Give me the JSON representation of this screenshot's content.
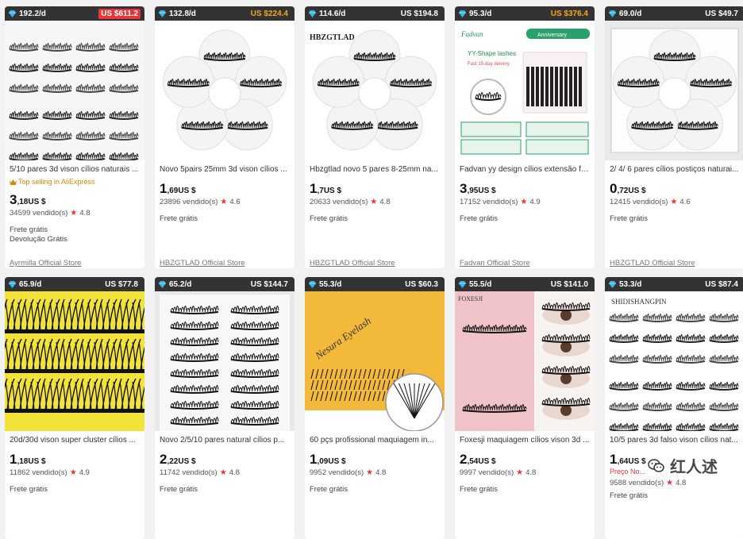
{
  "products": [
    {
      "sales_per_day": "192.2/d",
      "revenue": "US $611.2",
      "revenue_style": "hot",
      "title": "5/10 pares 3d vison cílios naturais ...",
      "badge": "Top selling in AliExpress",
      "price_int": "3",
      "price_dec": ",18",
      "currency": "US $",
      "sold": "34599 vendido(s)",
      "rating": "4.8",
      "shipping": "Frete grátis",
      "returns": "Devolução Grátis",
      "store": "Ayrmilla Official Store",
      "image": "lash-grid-dark"
    },
    {
      "sales_per_day": "132.8/d",
      "revenue": "US $224.4",
      "revenue_style": "gold",
      "title": "Novo 5pairs 25mm 3d vison cílios ...",
      "price_int": "1",
      "price_dec": ",69",
      "currency": "US $",
      "sold": "23896 vendido(s)",
      "rating": "4.6",
      "shipping": "Frete grátis",
      "store": "HBZGTLAD Official Store",
      "image": "lash-flower"
    },
    {
      "sales_per_day": "114.6/d",
      "revenue": "US $194.8",
      "revenue_style": "plain",
      "title": "Hbzgtlad novo 5 pares 8-25mm na...",
      "price_int": "1",
      "price_dec": ",7",
      "currency": "US $",
      "sold": "20633 vendido(s)",
      "rating": "4.8",
      "shipping": "Frete grátis",
      "store": "HBZGTLAD Official Store",
      "image": "lash-flower-branded",
      "brand_text": "HBZGTLAD"
    },
    {
      "sales_per_day": "95.3/d",
      "revenue": "US $376.4",
      "revenue_style": "gold",
      "title": "Fadvan yy design cílios extensão fa...",
      "price_int": "3",
      "price_dec": ",95",
      "currency": "US $",
      "sold": "17152 vendido(s)",
      "rating": "4.9",
      "shipping": "Frete grátis",
      "store": "Fadvan Official Store",
      "image": "lash-extension-box",
      "brand_text": "Fadvan",
      "anniv_text": "Anniversary",
      "promo_line1": "YY-Shape lashes",
      "promo_line2": "Fast 15-day deivery"
    },
    {
      "sales_per_day": "69.0/d",
      "revenue": "US $49.7",
      "revenue_style": "plain",
      "title": "2/ 4/ 6 pares cílios postiços naturai...",
      "price_int": "0",
      "price_dec": ",72",
      "currency": "US $",
      "sold": "12415 vendido(s)",
      "rating": "4.6",
      "shipping": "Frete grátis",
      "store": "HBZGTLAD Official Store",
      "image": "lash-flower-box"
    },
    {
      "sales_per_day": "65.9/d",
      "revenue": "US $77.8",
      "revenue_style": "plain",
      "title": "20d/30d vison super cluster cílios ...",
      "price_int": "1",
      "price_dec": ",18",
      "currency": "US $",
      "sold": "11862 vendido(s)",
      "rating": "4.9",
      "shipping": "Frete grátis",
      "image": "lash-cluster-yellow"
    },
    {
      "sales_per_day": "65.2/d",
      "revenue": "US $144.7",
      "revenue_style": "plain",
      "title": "Novo 2/5/10 pares natural cílios p...",
      "price_int": "2",
      "price_dec": ",22",
      "currency": "US $",
      "sold": "11742 vendido(s)",
      "rating": "4.8",
      "shipping": "Frete grátis",
      "image": "lash-strip-tray"
    },
    {
      "sales_per_day": "55.3/d",
      "revenue": "US $60.3",
      "revenue_style": "plain",
      "title": "60 pçs profissional maquiagem in...",
      "price_int": "1",
      "price_dec": ",09",
      "currency": "US $",
      "sold": "9952 vendido(s)",
      "rating": "4.8",
      "shipping": "Frete grátis",
      "image": "lash-individual-yellow",
      "brand_text": "Nesura Eyelash"
    },
    {
      "sales_per_day": "55.5/d",
      "revenue": "US $141.0",
      "revenue_style": "plain",
      "title": "Foxesji maquiagem cílios vison 3d ...",
      "price_int": "2",
      "price_dec": ",54",
      "currency": "US $",
      "sold": "9997 vendido(s)",
      "rating": "4.8",
      "shipping": "Frete grátis",
      "image": "lash-pink-eyes",
      "brand_text": "FOXESJI"
    },
    {
      "sales_per_day": "53.3/d",
      "revenue": "US $87.4",
      "revenue_style": "plain",
      "title": "10/5 pares 3d falso vison cílios nat...",
      "price_int": "1",
      "price_dec": ",64",
      "currency": "US $",
      "sold": "9588 vendido(s)",
      "rating": "4.8",
      "shipping": "Frete grátis",
      "promo": "Preço No...",
      "image": "lash-grid-light",
      "brand_text": "SHIDISHANGPIN"
    }
  ],
  "watermark": {
    "text": "红人述",
    "icon": "wechat-icon"
  },
  "colors": {
    "bar_bg": "#333333",
    "gold": "#f7a61c",
    "hot": "#e8353a",
    "star": "#e8353a"
  }
}
